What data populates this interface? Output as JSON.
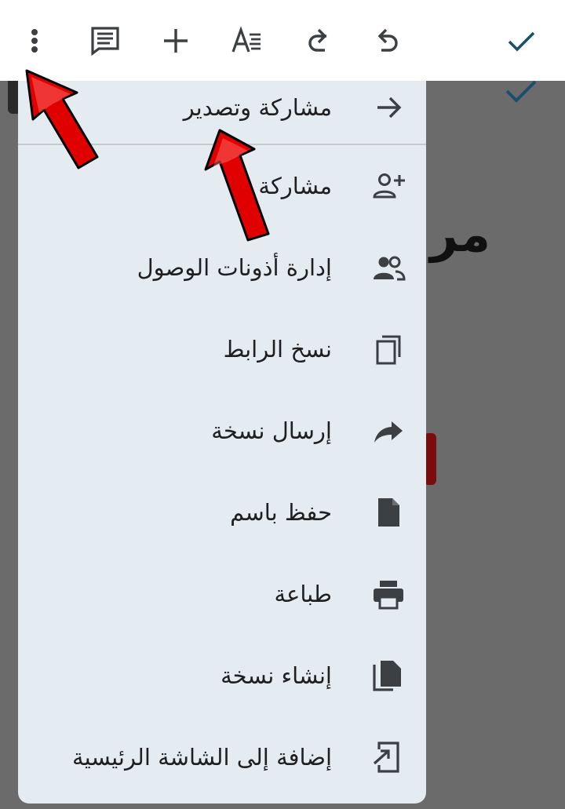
{
  "toolbar": {
    "more_icon": "more-vert-icon",
    "comment_icon": "comment-icon",
    "add_icon": "add-icon",
    "format_icon": "text-format-icon",
    "redo_icon": "redo-icon",
    "undo_icon": "undo-icon",
    "done_icon": "check-icon"
  },
  "menu": {
    "items": [
      {
        "label": "مشاركة وتصدير",
        "icon": "arrow-forward-icon"
      },
      {
        "label": "مشاركة",
        "icon": "person-add-icon"
      },
      {
        "label": "إدارة أذونات الوصول",
        "icon": "people-icon"
      },
      {
        "label": "نسخ الرابط",
        "icon": "copy-icon"
      },
      {
        "label": "إرسال نسخة",
        "icon": "share-arrow-icon"
      },
      {
        "label": "حفظ باسم",
        "icon": "file-icon"
      },
      {
        "label": "طباعة",
        "icon": "print-icon"
      },
      {
        "label": "إنشاء نسخة",
        "icon": "file-copy-icon"
      },
      {
        "label": "إضافة إلى الشاشة الرئيسية",
        "icon": "add-to-home-icon"
      }
    ]
  },
  "background": {
    "partial_text": "مر"
  },
  "colors": {
    "accent": "#1a73e8",
    "check": "#1b4f6e",
    "menu_bg": "#e4ebf1",
    "overlay": "#6b6b6b",
    "arrow_red": "#e00000"
  }
}
